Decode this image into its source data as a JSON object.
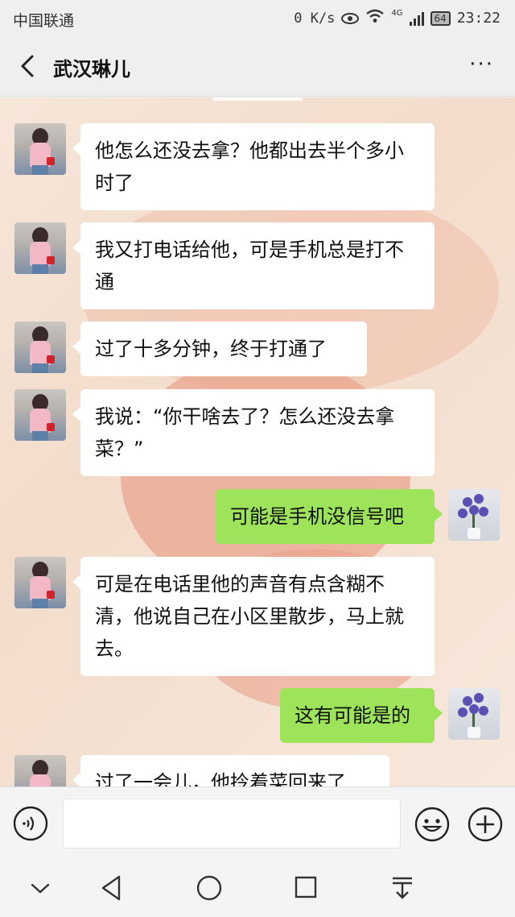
{
  "status_bar": {
    "carrier": "中国联通",
    "network_speed": "0 K/s",
    "network_type": "4G",
    "battery": "64",
    "time": "23:22"
  },
  "header": {
    "back_icon": "chevron-left-icon",
    "title": "武汉琳儿",
    "more_label": "···"
  },
  "messages": [
    {
      "side": "left",
      "avatar": "girl-avatar",
      "text": "他怎么还没去拿？他都出去半个多小时了"
    },
    {
      "side": "left",
      "avatar": "girl-avatar",
      "text": "我又打电话给他，可是手机总是打不通"
    },
    {
      "side": "left",
      "avatar": "girl-avatar",
      "text": "过了十多分钟，终于打通了"
    },
    {
      "side": "left",
      "avatar": "girl-avatar",
      "text": "我说：“你干啥去了？怎么还没去拿菜？”"
    },
    {
      "side": "right",
      "avatar": "flower-avatar",
      "text": "可能是手机没信号吧"
    },
    {
      "side": "left",
      "avatar": "girl-avatar",
      "text": "可是在电话里他的声音有点含糊不清，他说自己在小区里散步，马上就去。"
    },
    {
      "side": "right",
      "avatar": "flower-avatar",
      "text": "这有可能是的"
    },
    {
      "side": "left",
      "avatar": "girl-avatar",
      "text": "过了一会儿，他拎着菜回来了"
    }
  ],
  "input_bar": {
    "voice_icon": "voice-icon",
    "text_value": "",
    "emoji_icon": "emoji-icon",
    "plus_icon": "plus-icon"
  },
  "nav_bar": {
    "icons": [
      "chevron-down-icon",
      "back-triangle-icon",
      "home-circle-icon",
      "recents-square-icon",
      "notification-pull-icon"
    ]
  },
  "colors": {
    "sent_bubble": "#9de45a",
    "received_bubble": "#ffffff",
    "chat_background": "#f3dccb"
  }
}
